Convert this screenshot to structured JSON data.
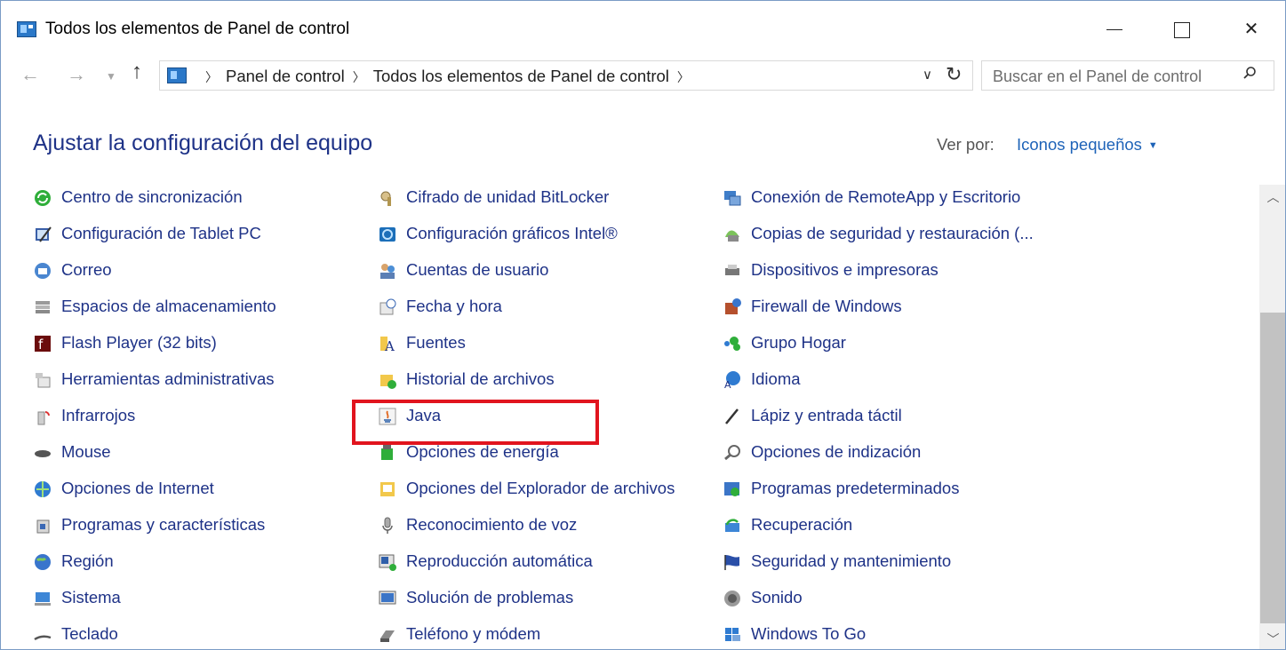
{
  "window": {
    "title": "Todos los elementos de Panel de control"
  },
  "nav": {
    "breadcrumbs": [
      "Panel de control",
      "Todos los elementos de Panel de control"
    ],
    "search_placeholder": "Buscar en el Panel de control"
  },
  "header": {
    "title": "Ajustar la configuración del equipo",
    "view_by_label": "Ver por:",
    "view_by_value": "Iconos pequeños"
  },
  "columns": [
    [
      {
        "label": "Centro de sincronización",
        "icon": "sync-center-icon"
      },
      {
        "label": "Configuración de Tablet PC",
        "icon": "tablet-pc-icon"
      },
      {
        "label": "Correo",
        "icon": "mail-icon"
      },
      {
        "label": "Espacios de almacenamiento",
        "icon": "storage-spaces-icon"
      },
      {
        "label": "Flash Player (32 bits)",
        "icon": "flash-player-icon"
      },
      {
        "label": "Herramientas administrativas",
        "icon": "admin-tools-icon"
      },
      {
        "label": "Infrarrojos",
        "icon": "infrared-icon"
      },
      {
        "label": "Mouse",
        "icon": "mouse-icon"
      },
      {
        "label": "Opciones de Internet",
        "icon": "internet-options-icon"
      },
      {
        "label": "Programas y características",
        "icon": "programs-features-icon"
      },
      {
        "label": "Región",
        "icon": "region-icon"
      },
      {
        "label": "Sistema",
        "icon": "system-icon"
      },
      {
        "label": "Teclado",
        "icon": "keyboard-icon"
      }
    ],
    [
      {
        "label": "Cifrado de unidad BitLocker",
        "icon": "bitlocker-icon"
      },
      {
        "label": "Configuración gráficos Intel®",
        "icon": "intel-graphics-icon"
      },
      {
        "label": "Cuentas de usuario",
        "icon": "user-accounts-icon"
      },
      {
        "label": "Fecha y hora",
        "icon": "date-time-icon"
      },
      {
        "label": "Fuentes",
        "icon": "fonts-icon"
      },
      {
        "label": "Historial de archivos",
        "icon": "file-history-icon"
      },
      {
        "label": "Java",
        "icon": "java-icon"
      },
      {
        "label": "Opciones de energía",
        "icon": "power-options-icon"
      },
      {
        "label": "Opciones del Explorador de archivos",
        "icon": "file-explorer-options-icon"
      },
      {
        "label": "Reconocimiento de voz",
        "icon": "speech-recognition-icon"
      },
      {
        "label": "Reproducción automática",
        "icon": "autoplay-icon"
      },
      {
        "label": "Solución de problemas",
        "icon": "troubleshooting-icon"
      },
      {
        "label": "Teléfono y módem",
        "icon": "phone-modem-icon"
      }
    ],
    [
      {
        "label": "Conexión de RemoteApp y Escritorio",
        "icon": "remoteapp-icon"
      },
      {
        "label": "Copias de seguridad y restauración (...",
        "icon": "backup-restore-icon"
      },
      {
        "label": "Dispositivos e impresoras",
        "icon": "devices-printers-icon"
      },
      {
        "label": "Firewall de Windows",
        "icon": "firewall-icon"
      },
      {
        "label": "Grupo Hogar",
        "icon": "homegroup-icon"
      },
      {
        "label": "Idioma",
        "icon": "language-icon"
      },
      {
        "label": "Lápiz y entrada táctil",
        "icon": "pen-touch-icon"
      },
      {
        "label": "Opciones de indización",
        "icon": "indexing-options-icon"
      },
      {
        "label": "Programas predeterminados",
        "icon": "default-programs-icon"
      },
      {
        "label": "Recuperación",
        "icon": "recovery-icon"
      },
      {
        "label": "Seguridad y mantenimiento",
        "icon": "security-maintenance-icon"
      },
      {
        "label": "Sonido",
        "icon": "sound-icon"
      },
      {
        "label": "Windows To Go",
        "icon": "windows-to-go-icon"
      }
    ]
  ],
  "colors": {
    "link": "#1e3287",
    "accent": "#1e63b8",
    "highlight": "#e1141e"
  }
}
